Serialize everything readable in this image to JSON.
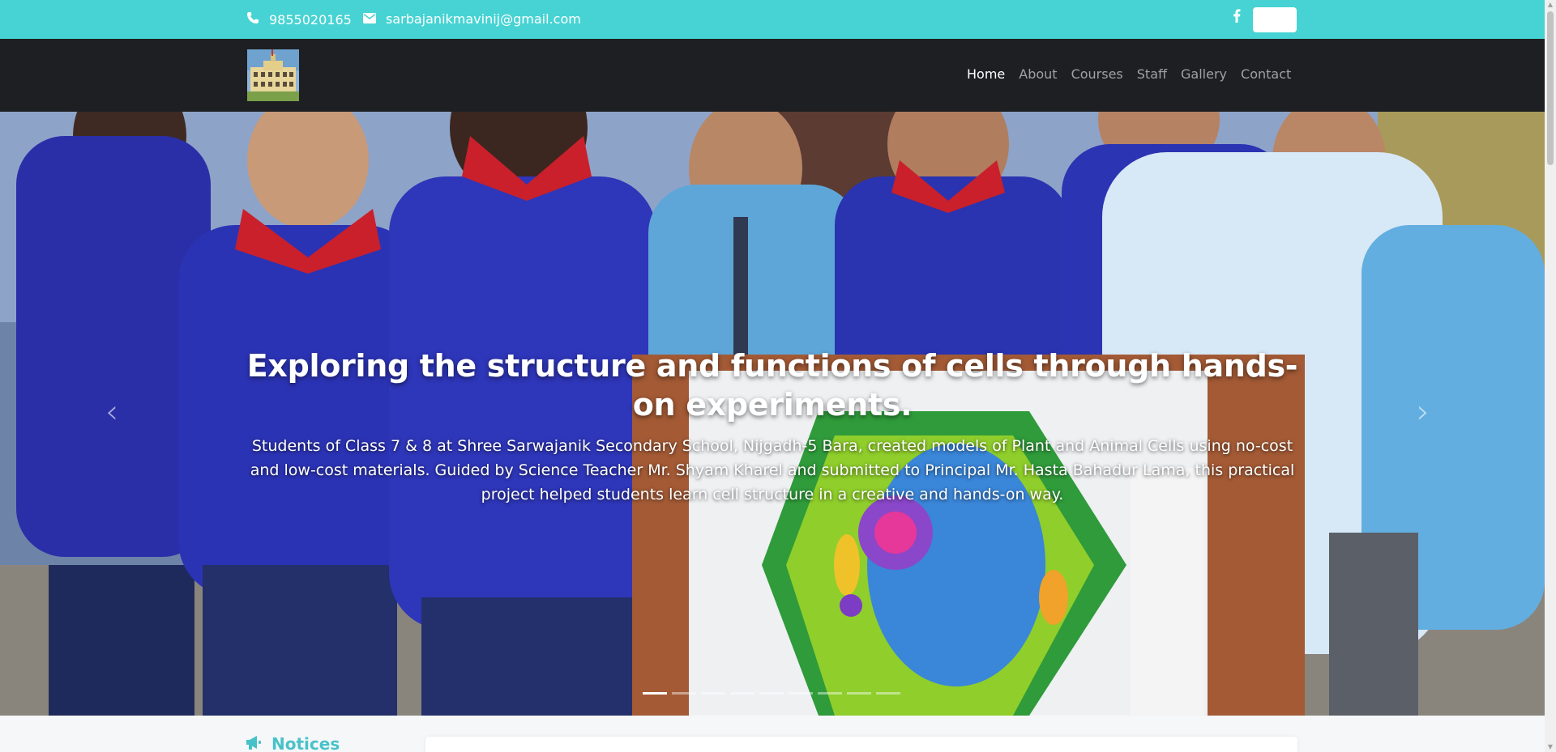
{
  "topbar": {
    "phone": "9855020165",
    "email": "sarbajanikmavinij@gmail.com",
    "social_icon": "facebook-icon"
  },
  "nav": {
    "items": [
      "Home",
      "About",
      "Courses",
      "Staff",
      "Gallery",
      "Contact"
    ],
    "active": "Home"
  },
  "hero": {
    "title": "Exploring the structure and functions of cells through hands-on experiments.",
    "description": "Students of Class 7 & 8 at Shree Sarwajanik Secondary School, Nijgadh-5 Bara, created models of Plant and Animal Cells using no-cost and low-cost materials. Guided by Science Teacher Mr. Shyam Kharel and submitted to Principal Mr. Hasta Bahadur Lama, this practical project helped students learn cell structure in a creative and hands-on way.",
    "prev_icon": "chevron-left-icon",
    "next_icon": "chevron-right-icon",
    "slide_count": 9,
    "active_slide": 1
  },
  "notices": {
    "title": "Notices",
    "icon": "megaphone-icon"
  },
  "colors": {
    "accent": "#47d3d3",
    "navbar": "#1d1f22",
    "notices_title": "#47c2c9"
  }
}
